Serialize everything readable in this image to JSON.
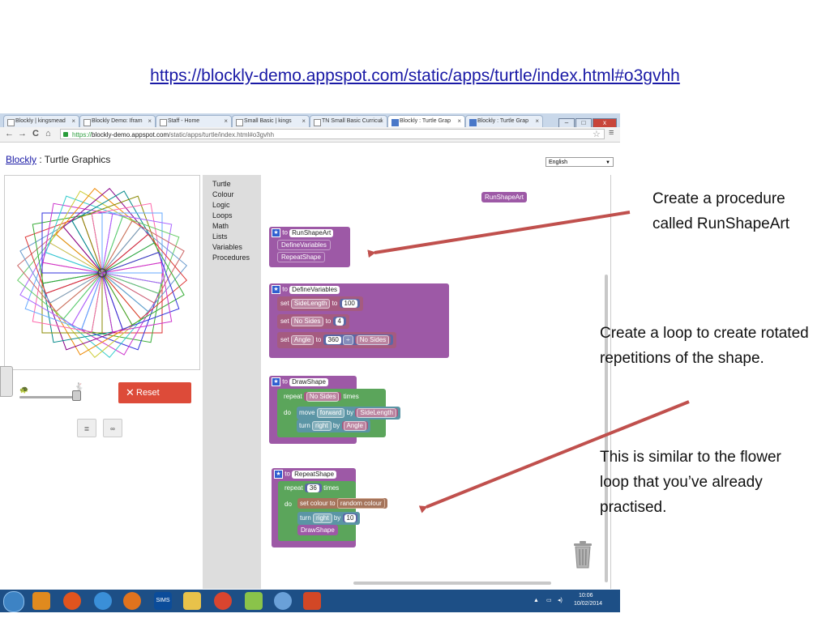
{
  "slide": {
    "title_url": "https://blockly-demo.appspot.com/static/apps/turtle/index.html#o3gvhh",
    "callouts": [
      "Create a procedure called RunShapeArt",
      "Create a loop to create rotated repetitions of the shape.",
      "This is similar to the flower loop that you’ve already practised."
    ]
  },
  "browser": {
    "tabs": [
      {
        "label": "Blockly | kingsmead"
      },
      {
        "label": "Blockly Demo: Ifram"
      },
      {
        "label": "Staff - Home"
      },
      {
        "label": "Small Basic | kings"
      },
      {
        "label": "TN Small Basic Curricul"
      },
      {
        "label": "Blockly : Turtle Grap"
      },
      {
        "label": "Blockly : Turtle Grap"
      }
    ],
    "active_tab_index": 5,
    "address": {
      "scheme": "https://",
      "host": "blockly-demo.appspot.com",
      "path": "/static/apps/turtle/index.html#o3gvhh"
    },
    "nav": {
      "back": "←",
      "forward": "→",
      "reload": "C",
      "home": "⌂",
      "star": "☆",
      "menu": "≡"
    },
    "window_buttons": {
      "minimize": "–",
      "maximize": "□",
      "close": "x"
    }
  },
  "app": {
    "brand_link": "Blockly",
    "title_rest": " : Turtle Graphics",
    "language": "English",
    "reset_label": "Reset",
    "reset_icon": "✕",
    "speed_slider_value": 0.95,
    "toolbox": [
      "Turtle",
      "Colour",
      "Logic",
      "Loops",
      "Math",
      "Lists",
      "Variables",
      "Procedures"
    ],
    "call_block": "RunShapeArt",
    "blocks": {
      "run": {
        "to": "to",
        "name": "RunShapeArt",
        "calls": [
          "DefineVariables",
          "RepeatShape"
        ]
      },
      "define": {
        "to": "to",
        "name": "DefineVariables",
        "set": "set",
        "to_word": "to",
        "var1": "SideLength",
        "val1": "100",
        "var2": "No Sides",
        "val2": "4",
        "var3": "Angle",
        "num": "360",
        "op": "÷",
        "var3ref": "No Sides"
      },
      "draw": {
        "to": "to",
        "name": "DrawShape",
        "repeat": "repeat",
        "count_var": "No Sides",
        "times": "times",
        "do": "do",
        "move": "move",
        "dir": "forward",
        "by": "by",
        "dist_var": "SideLength",
        "turn": "turn",
        "turn_dir": "right",
        "by2": "by",
        "angle_var": "Angle"
      },
      "repeat_shape": {
        "to": "to",
        "name": "RepeatShape",
        "repeat": "repeat",
        "count": "36",
        "times": "times",
        "do": "do",
        "set_colour": "set colour to",
        "random_colour": "random colour",
        "turn": "turn",
        "turn_dir": "right",
        "by": "by",
        "angle": "10",
        "call": "DrawShape"
      }
    }
  },
  "taskbar": {
    "sims_label": "SIMS",
    "time": "10:06",
    "date": "10/02/2014"
  },
  "colors": {
    "procedure": "#9d59a6",
    "loop": "#5ba55b",
    "variable": "#a55b80",
    "math": "#5b67a5",
    "colour": "#a5745b",
    "reset": "#dd4b39",
    "arrow": "#c0504d"
  },
  "icons": [
    "turtle-slow-icon",
    "turtle-fast-icon",
    "trash-icon",
    "star-icon",
    "lock-icon"
  ]
}
